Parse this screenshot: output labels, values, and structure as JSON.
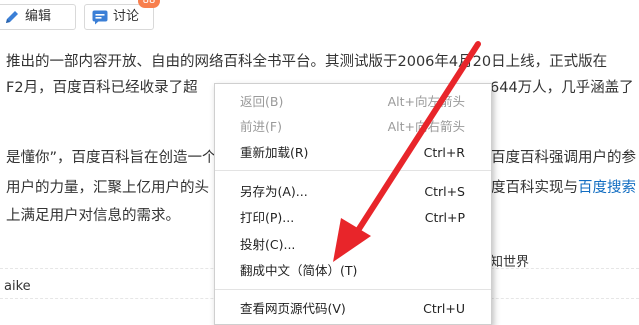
{
  "toolbar": {
    "edit_label": "编辑",
    "discuss_label": "讨论",
    "discuss_count": "88"
  },
  "article": {
    "line1": "推出的一部内容开放、自由的网络百科全书平台。其测试版于2006年4月20日上线，正式版在",
    "line2a": "F2月，百度百科已经收录了超",
    "line2b": "644万人，几乎涵盖了",
    "line3a": "是懂你”，百度百科旨在创造一个",
    "line3b": "百度百科强调用户的参",
    "line4a": "用户的力量，汇聚上亿用户的头",
    "line4b": "度百科实现与",
    "line4link": "百度搜索",
    "line5": "上满足用户对信息的需求。",
    "footer_right": "知世界",
    "footer_left": "aike"
  },
  "context_menu": {
    "items": [
      {
        "label": "返回(B)",
        "shortcut": "Alt+向左箭头",
        "disabled": true
      },
      {
        "label": "前进(F)",
        "shortcut": "Alt+向右箭头",
        "disabled": true
      },
      {
        "label": "重新加载(R)",
        "shortcut": "Ctrl+R",
        "disabled": false
      },
      {
        "label": "另存为(A)...",
        "shortcut": "Ctrl+S",
        "disabled": false
      },
      {
        "label": "打印(P)...",
        "shortcut": "Ctrl+P",
        "disabled": false
      },
      {
        "label": "投射(C)...",
        "shortcut": "",
        "disabled": false
      },
      {
        "label": "翻成中文（简体）(T)",
        "shortcut": "",
        "disabled": false
      },
      {
        "label": "查看网页源代码(V)",
        "shortcut": "Ctrl+U",
        "disabled": false
      }
    ]
  },
  "colors": {
    "arrow": "#e8252a",
    "link": "#136ec2",
    "badge": "#f87f4d",
    "icon_blue": "#3b7fd6"
  },
  "icons": [
    "pencil-icon",
    "chat-bubble-icon",
    "red-arrow-annotation"
  ]
}
